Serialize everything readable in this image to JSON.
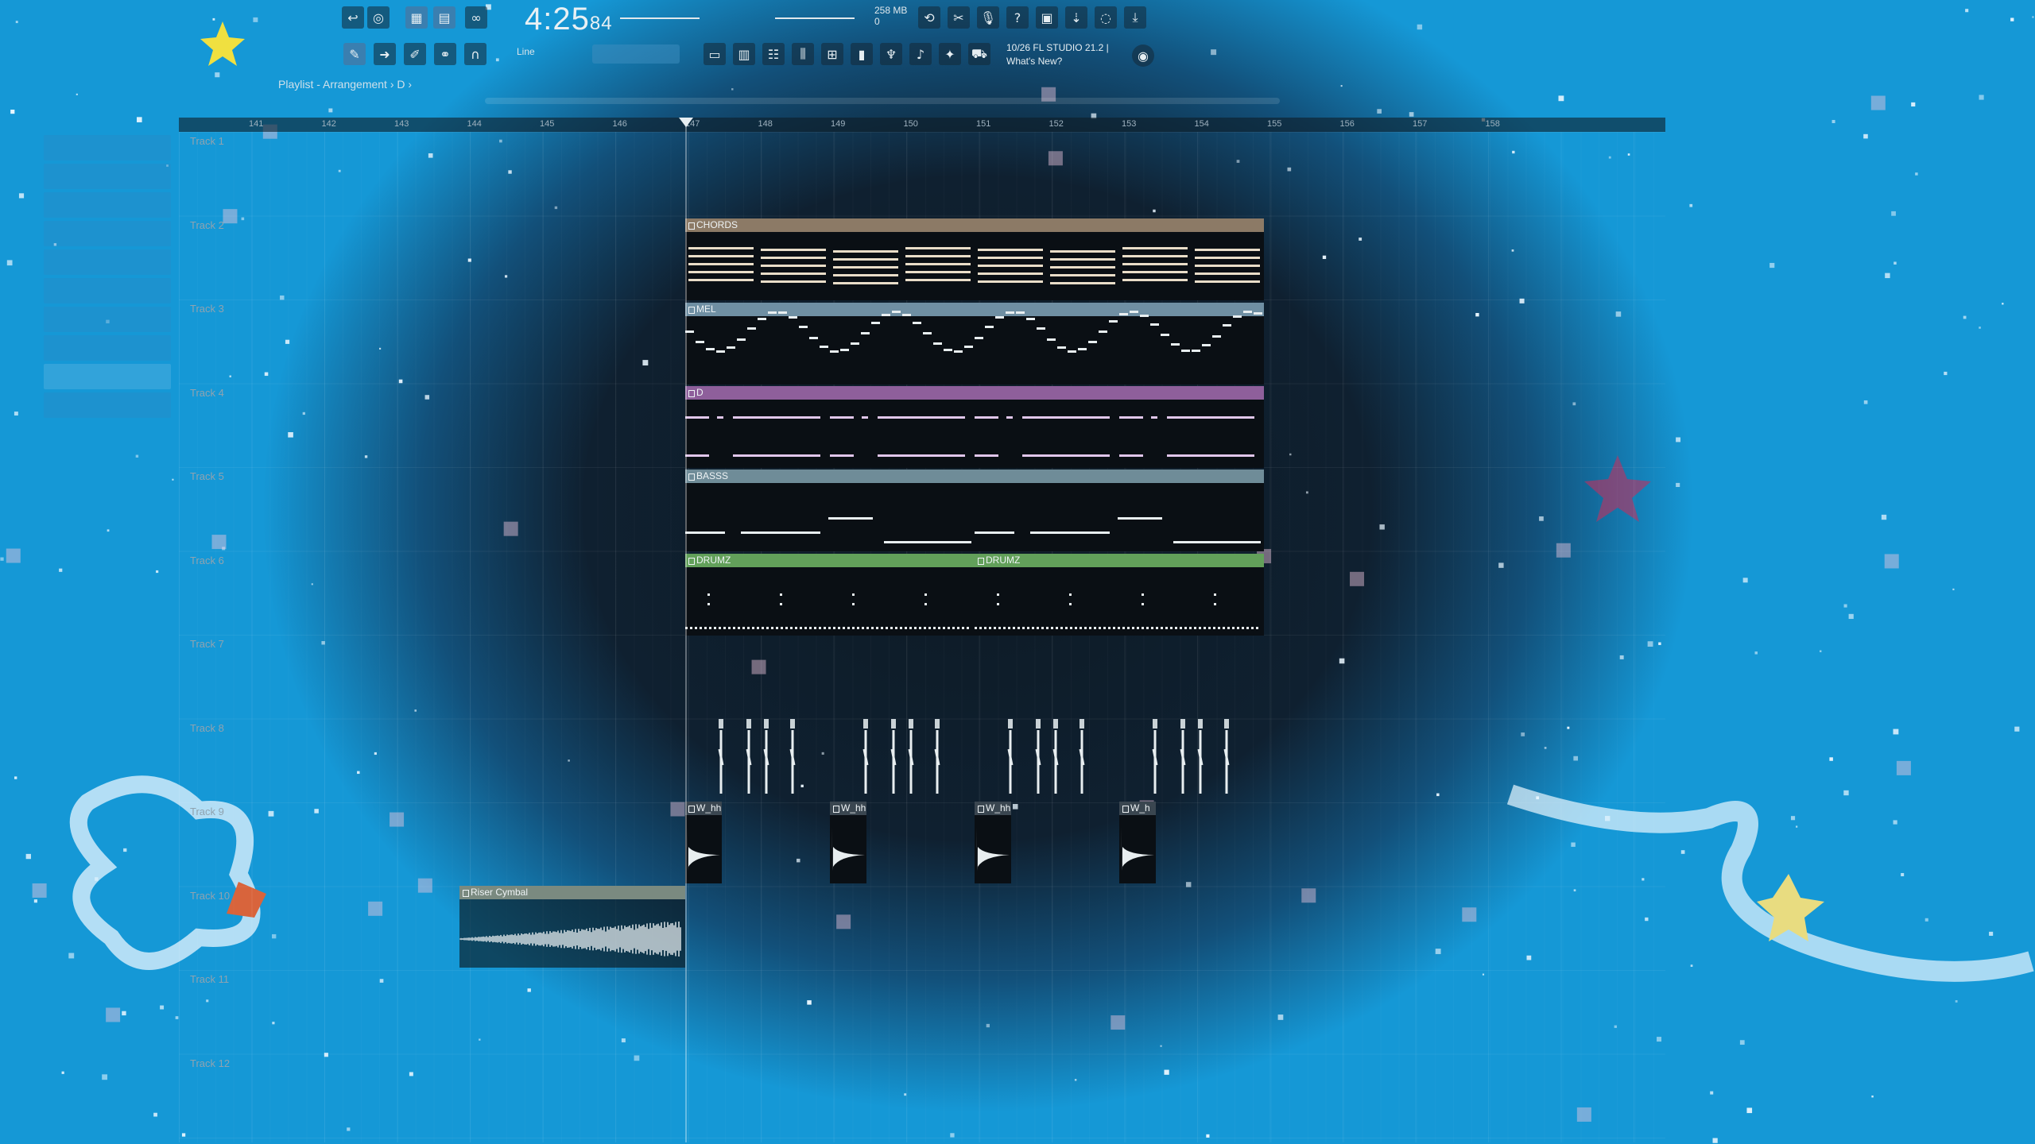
{
  "toolbar": {
    "time_main": "4:25",
    "time_sub": "84",
    "memory": "258 MB",
    "cpu": "0",
    "snap_label": "Line",
    "hint_line1": "10/26  FL STUDIO 21.2 |",
    "hint_line2": "What's New?"
  },
  "breadcrumb": "Playlist - Arrangement › D ›",
  "colors": {
    "chords": "#8c7a66",
    "mel": "#6f8fa3",
    "d": "#8e5f9b",
    "basss": "#6f8c98",
    "drumz": "#62a05a",
    "audio": "#7a8a80"
  },
  "ruler": {
    "bars": [
      "141",
      "142",
      "143",
      "144",
      "145",
      "146",
      "147",
      "148",
      "149",
      "150",
      "151",
      "152",
      "153",
      "154",
      "155",
      "156",
      "157",
      "158"
    ]
  },
  "tracks": [
    "Track 1",
    "Track 2",
    "Track 3",
    "Track 4",
    "Track 5",
    "Track 6",
    "Track 7",
    "Track 8",
    "Track 9",
    "Track 10",
    "Track 11",
    "Track 12"
  ],
  "clips": {
    "chords": "CHORDS",
    "mel": "MEL",
    "d": "D",
    "basss": "BASSS",
    "drumz_a": "DRUMZ",
    "drumz_b": "DRUMZ",
    "hh1": "W_hh",
    "hh2": "W_hh",
    "hh3": "W_hh",
    "hh4": "W_h",
    "riser": "Riser Cymbal"
  },
  "icons": [
    "undo-icon",
    "redo-icon",
    "metronome-icon",
    "mixer-icon",
    "channel-rack-icon",
    "piano-roll-icon",
    "browser-icon",
    "plugin-icon",
    "help-icon",
    "save-icon",
    "export-icon",
    "chat-icon",
    "download-icon"
  ]
}
